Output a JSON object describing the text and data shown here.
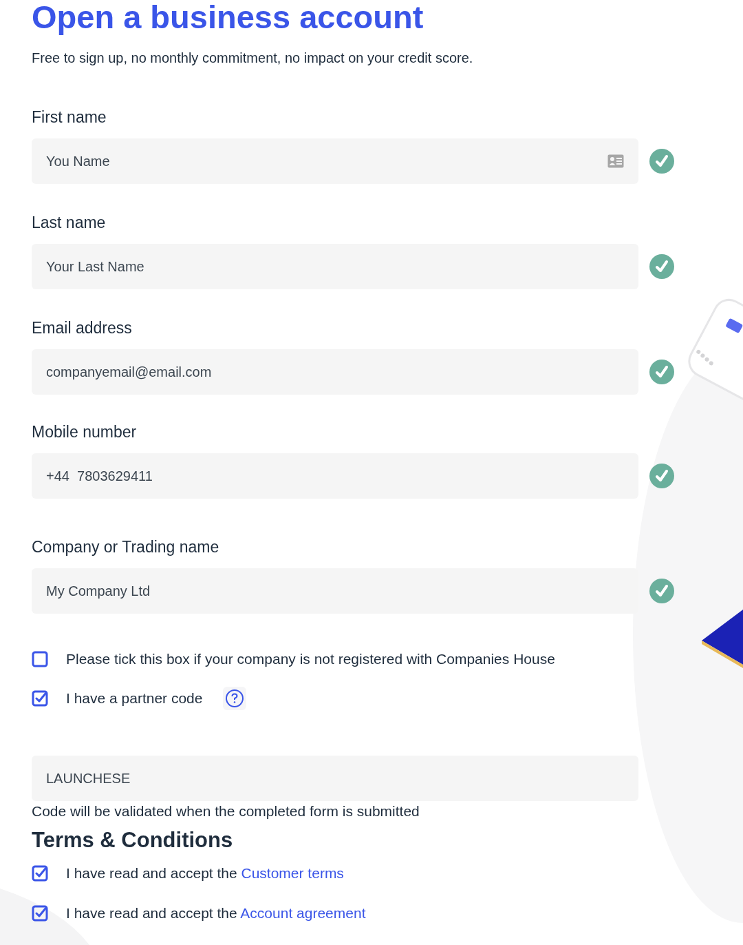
{
  "title": "Open a business account",
  "subtitle": "Free to sign up, no monthly commitment, no impact on your credit score.",
  "fields": [
    {
      "label": "First name",
      "value": "You Name",
      "valid": true,
      "contact_icon": true
    },
    {
      "label": "Last name",
      "value": "Your Last Name",
      "valid": true,
      "contact_icon": false
    },
    {
      "label": "Email address",
      "value": "companyemail@email.com",
      "valid": true,
      "contact_icon": false
    },
    {
      "label": "Mobile number",
      "value": "+44  7803629411",
      "valid": true,
      "contact_icon": false
    },
    {
      "label": "Company or Trading name",
      "value": "My Company Ltd",
      "valid": true,
      "contact_icon": false
    }
  ],
  "options": [
    {
      "label": "Please tick this box if your company is not registered with Companies House",
      "checked": false,
      "help": false
    },
    {
      "label": "I have a partner code",
      "checked": true,
      "help": true
    }
  ],
  "partner_code": {
    "value": "LAUNCHESE",
    "note": "Code will be validated when the completed form is submitted"
  },
  "terms": {
    "heading": "Terms & Conditions",
    "items": [
      {
        "text": "I have read and accept the ",
        "link": "Customer terms",
        "checked": true
      },
      {
        "text": "I have read and accept the ",
        "link": "Account agreement",
        "checked": true
      }
    ]
  }
}
